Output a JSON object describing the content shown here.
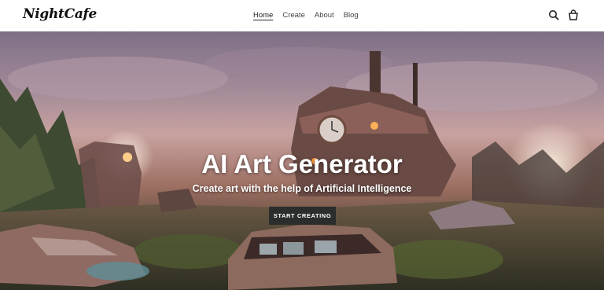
{
  "header": {
    "logo": "NightCafe",
    "nav": [
      {
        "label": "Home",
        "active": true
      },
      {
        "label": "Create",
        "active": false
      },
      {
        "label": "About",
        "active": false
      },
      {
        "label": "Blog",
        "active": false
      }
    ],
    "icons": [
      "search-icon",
      "cart-icon"
    ]
  },
  "hero": {
    "title": "AI Art Generator",
    "subtitle": "Create art with the help of Artificial Intelligence",
    "cta_label": "START CREATING",
    "cta_color": "#2b2c2c"
  }
}
